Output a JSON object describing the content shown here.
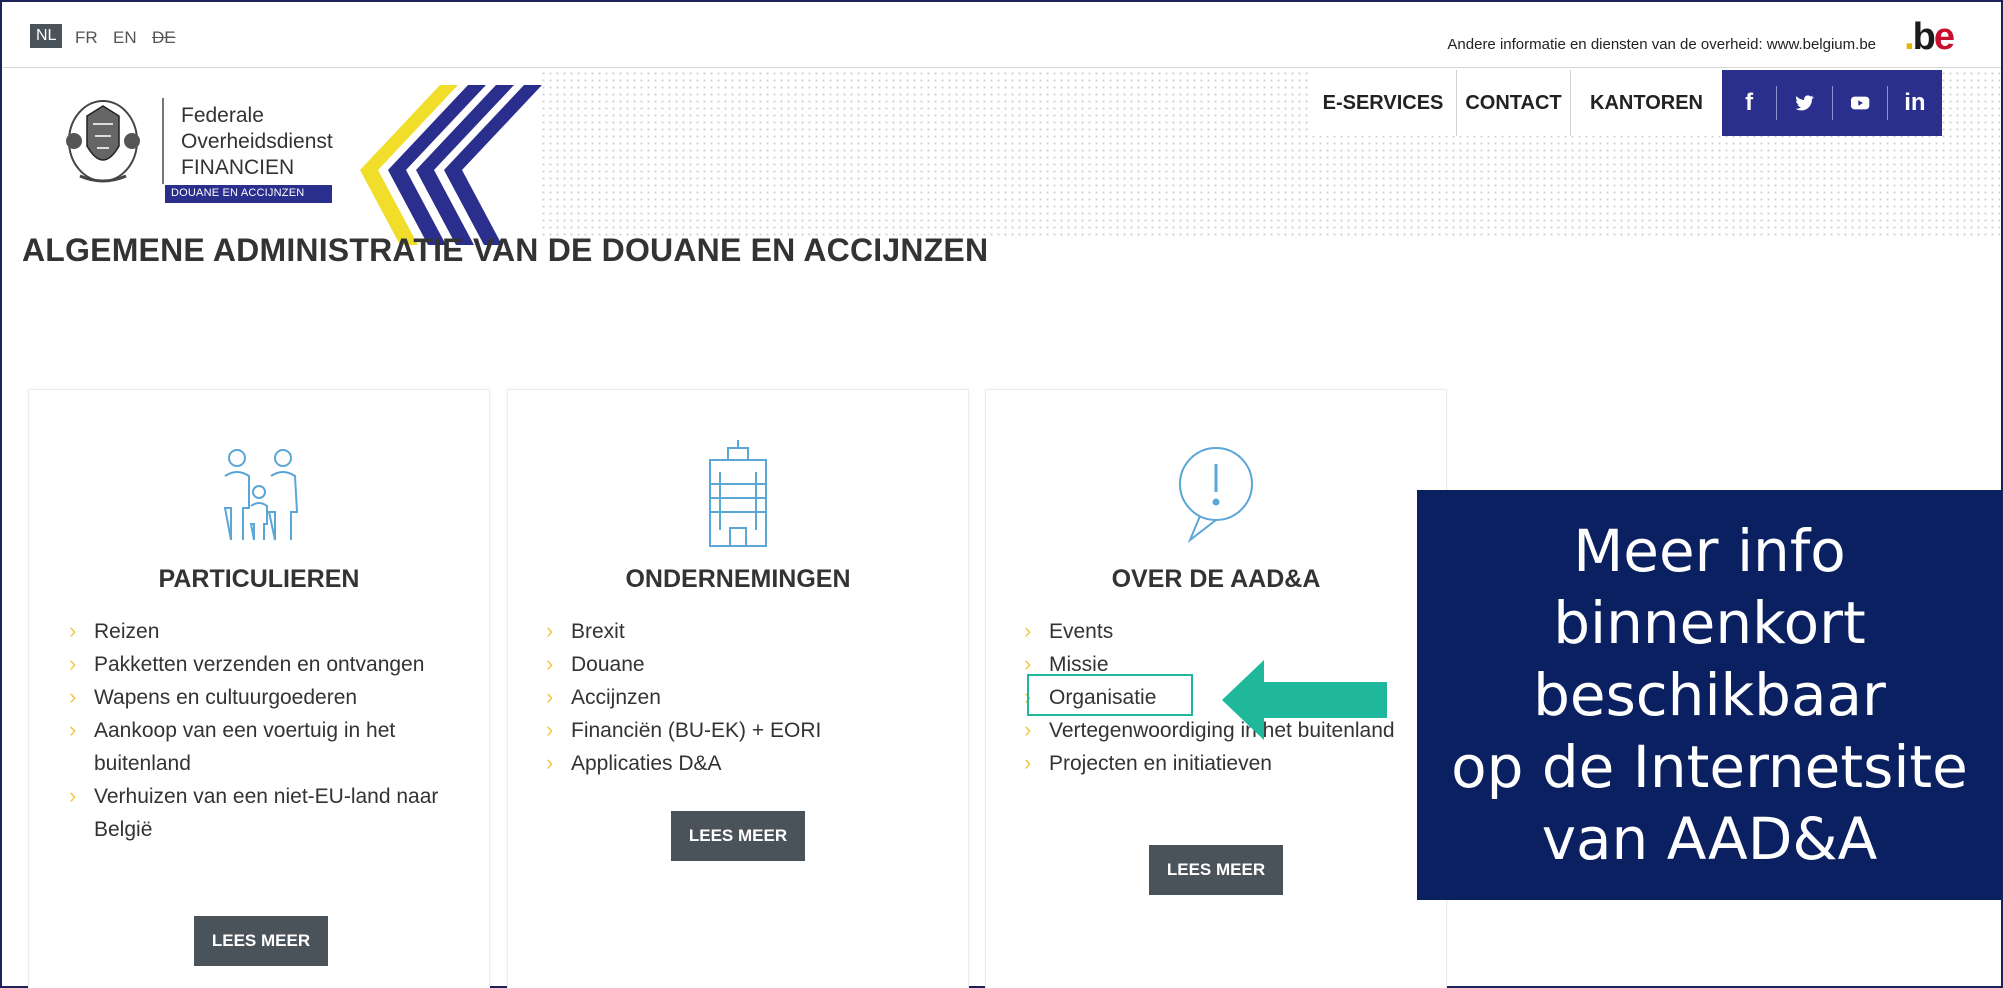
{
  "languages": [
    {
      "code": "NL",
      "active": true
    },
    {
      "code": "FR",
      "active": false
    },
    {
      "code": "EN",
      "active": false
    },
    {
      "code": "DE",
      "active": false,
      "strikethrough": true
    }
  ],
  "topinfo": "Andere informatie en diensten van de overheid: www.belgium.be",
  "be_logo": {
    "dot": ".",
    "b": "b",
    "e": "e"
  },
  "logo": {
    "line1": "Federale",
    "line2": "Overheidsdienst",
    "line3": "FINANCIEN",
    "tag": "DOUANE EN ACCIJNZEN"
  },
  "nav": {
    "eservices": "E-SERVICES",
    "contact": "CONTACT",
    "kantoren": "KANTOREN"
  },
  "social": {
    "facebook": "f",
    "twitter": "twitter-icon",
    "youtube": "youtube-icon",
    "linkedin": "in"
  },
  "page_title": "ALGEMENE ADMINISTRATIE VAN DE DOUANE EN ACCIJNZEN",
  "cards": [
    {
      "title": "PARTICULIEREN",
      "icon": "family-icon",
      "items": [
        "Reizen",
        "Pakketten verzenden en ontvangen",
        "Wapens en cultuurgoederen",
        "Aankoop van een voertuig in het buitenland",
        "Verhuizen van een niet-EU-land naar België"
      ],
      "button": "LEES MEER"
    },
    {
      "title": "ONDERNEMINGEN",
      "icon": "building-icon",
      "items": [
        "Brexit",
        "Douane",
        "Accijnzen",
        "Financiën (BU-EK) + EORI",
        "Applicaties D&A"
      ],
      "button": "LEES MEER"
    },
    {
      "title": "OVER DE AAD&A",
      "icon": "exclamation-bubble-icon",
      "items": [
        "Events",
        "Missie",
        "Organisatie",
        "Vertegenwoordiging in het buitenland",
        "Projecten en initiatieven"
      ],
      "button": "LEES MEER"
    }
  ],
  "overlay_text": "Meer info\nbinnenkort\nbeschikbaar\nop de Internetsite\nvan AAD&A",
  "colors": {
    "brand_blue": "#2a2e8c",
    "overlay_navy": "#0b2060",
    "button_gray": "#4a525a",
    "arrow_green": "#1fb89a",
    "bullet_yellow": "#f2c94c"
  }
}
